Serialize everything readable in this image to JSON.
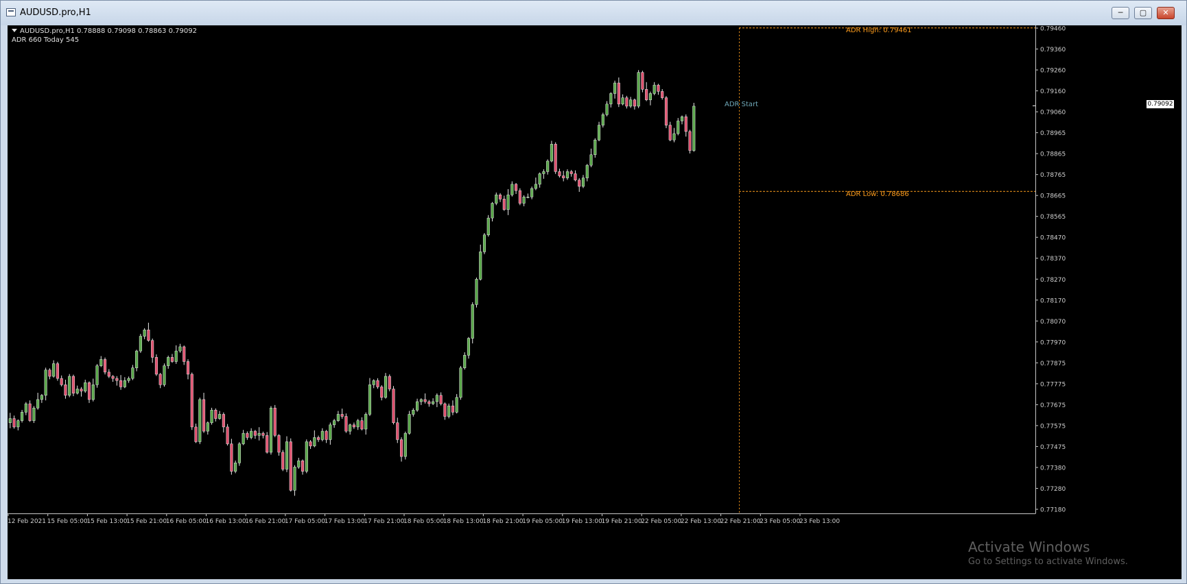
{
  "window": {
    "title": "AUDUSD.pro,H1",
    "buttons": {
      "minimize": "─",
      "maximize": "▢",
      "close": "✕"
    }
  },
  "chart_info": {
    "symbol_line": "AUDUSD.pro,H1  0.78888 0.79098 0.78863 0.79092",
    "adr_line": "ADR 660  Today 545"
  },
  "annotations": {
    "adr_high": "ADR High: 0.79461",
    "adr_low": "ADR Low: 0.78686",
    "adr_start": "ADR Start",
    "current_price": "0.79092"
  },
  "watermark": {
    "line1": "Activate Windows",
    "line2": "Go to Settings to activate Windows."
  },
  "colors": {
    "bull": "#5aa84a",
    "bear": "#e0506e",
    "adr": "#ff9d1c",
    "grid_text": "#d0d0d0"
  },
  "chart_data": {
    "type": "candlestick",
    "price_axis_labels": [
      "0.79460",
      "0.79360",
      "0.79260",
      "0.79160",
      "0.79060",
      "0.78965",
      "0.78865",
      "0.78765",
      "0.78665",
      "0.78565",
      "0.78470",
      "0.78370",
      "0.78270",
      "0.78170",
      "0.78070",
      "0.77970",
      "0.77875",
      "0.77775",
      "0.77675",
      "0.77575",
      "0.77475",
      "0.77380",
      "0.77280",
      "0.77180"
    ],
    "time_axis_labels": [
      "12 Feb 2021",
      "15 Feb 05:00",
      "15 Feb 13:00",
      "15 Feb 21:00",
      "16 Feb 05:00",
      "16 Feb 13:00",
      "16 Feb 21:00",
      "17 Feb 05:00",
      "17 Feb 13:00",
      "17 Feb 21:00",
      "18 Feb 05:00",
      "18 Feb 13:00",
      "18 Feb 21:00",
      "19 Feb 05:00",
      "19 Feb 13:00",
      "19 Feb 21:00",
      "22 Feb 05:00",
      "22 Feb 13:00",
      "22 Feb 21:00",
      "23 Feb 05:00",
      "23 Feb 13:00"
    ],
    "ylim": [
      0.7718,
      0.7946
    ],
    "adr_high": 0.79461,
    "adr_low": 0.78686,
    "adr_start_label": "22 Feb 21:00",
    "last_price": 0.79092,
    "ohlc_close": [
      0.7761,
      0.7757,
      0.776,
      0.7764,
      0.7768,
      0.776,
      0.7766,
      0.777,
      0.7772,
      0.7784,
      0.7781,
      0.7787,
      0.778,
      0.7777,
      0.7772,
      0.7781,
      0.7773,
      0.7775,
      0.7774,
      0.7778,
      0.777,
      0.7777,
      0.7786,
      0.7789,
      0.7783,
      0.7781,
      0.778,
      0.7779,
      0.7776,
      0.7779,
      0.778,
      0.7785,
      0.7793,
      0.78,
      0.7803,
      0.7798,
      0.779,
      0.7782,
      0.7777,
      0.7786,
      0.779,
      0.7788,
      0.7793,
      0.7795,
      0.7788,
      0.7782,
      0.7757,
      0.775,
      0.777,
      0.7755,
      0.7759,
      0.7765,
      0.7761,
      0.7763,
      0.7757,
      0.7749,
      0.7736,
      0.774,
      0.7749,
      0.7754,
      0.7752,
      0.7755,
      0.7753,
      0.7754,
      0.7753,
      0.7745,
      0.7766,
      0.7753,
      0.7745,
      0.7737,
      0.775,
      0.7727,
      0.7738,
      0.7741,
      0.7736,
      0.775,
      0.7748,
      0.7752,
      0.7751,
      0.7755,
      0.7751,
      0.7758,
      0.776,
      0.7763,
      0.7762,
      0.7755,
      0.7758,
      0.7757,
      0.776,
      0.7756,
      0.7763,
      0.7777,
      0.7779,
      0.7776,
      0.7771,
      0.7781,
      0.7775,
      0.7759,
      0.7751,
      0.7743,
      0.7754,
      0.7763,
      0.7765,
      0.7769,
      0.777,
      0.7769,
      0.7768,
      0.7769,
      0.7772,
      0.7768,
      0.7762,
      0.7767,
      0.7764,
      0.7771,
      0.7785,
      0.7791,
      0.7799,
      0.7815,
      0.7827,
      0.784,
      0.7848,
      0.7856,
      0.7863,
      0.7867,
      0.7865,
      0.786,
      0.7867,
      0.7872,
      0.7869,
      0.7863,
      0.7866,
      0.7866,
      0.787,
      0.7872,
      0.7877,
      0.7878,
      0.7883,
      0.7891,
      0.7878,
      0.7876,
      0.7875,
      0.7878,
      0.7877,
      0.7874,
      0.7871,
      0.7875,
      0.7881,
      0.7886,
      0.7893,
      0.79,
      0.7905,
      0.791,
      0.7915,
      0.792,
      0.791,
      0.7913,
      0.7909,
      0.7912,
      0.7909,
      0.7925,
      0.7917,
      0.7912,
      0.7915,
      0.7919,
      0.7916,
      0.7913,
      0.79,
      0.7893,
      0.7896,
      0.7902,
      0.7904,
      0.7897,
      0.7888,
      0.7909
    ]
  }
}
